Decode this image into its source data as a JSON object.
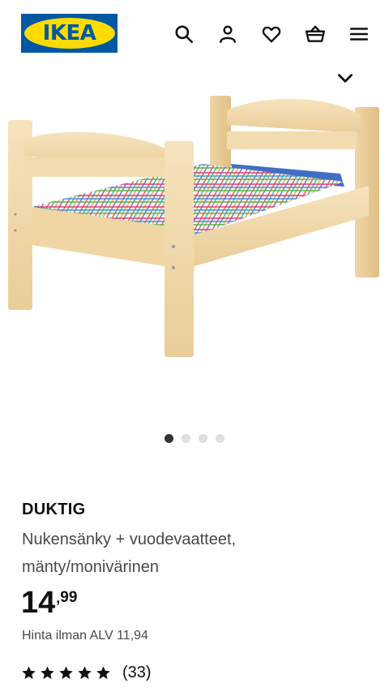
{
  "header": {
    "logo_text": "IKEA",
    "icons": [
      "search-icon",
      "user-icon",
      "heart-icon",
      "basket-icon",
      "menu-icon"
    ]
  },
  "gallery": {
    "total_images": 4,
    "active_index": 0
  },
  "product": {
    "name": "DUKTIG",
    "description_line1": "Nukensänky + vuodevaatteet,",
    "description_line2": "mänty/monivärinen",
    "price_integer": "14",
    "price_separator": ",",
    "price_decimal": "99",
    "vat_text": "Hinta ilman ALV 11,94",
    "rating_stars": 4.5,
    "rating_count": "(33)"
  },
  "colors": {
    "brand_blue": "#0058a3",
    "brand_yellow": "#ffdb00",
    "active_dot": "#333333",
    "inactive_dot": "#dfdfdf"
  }
}
